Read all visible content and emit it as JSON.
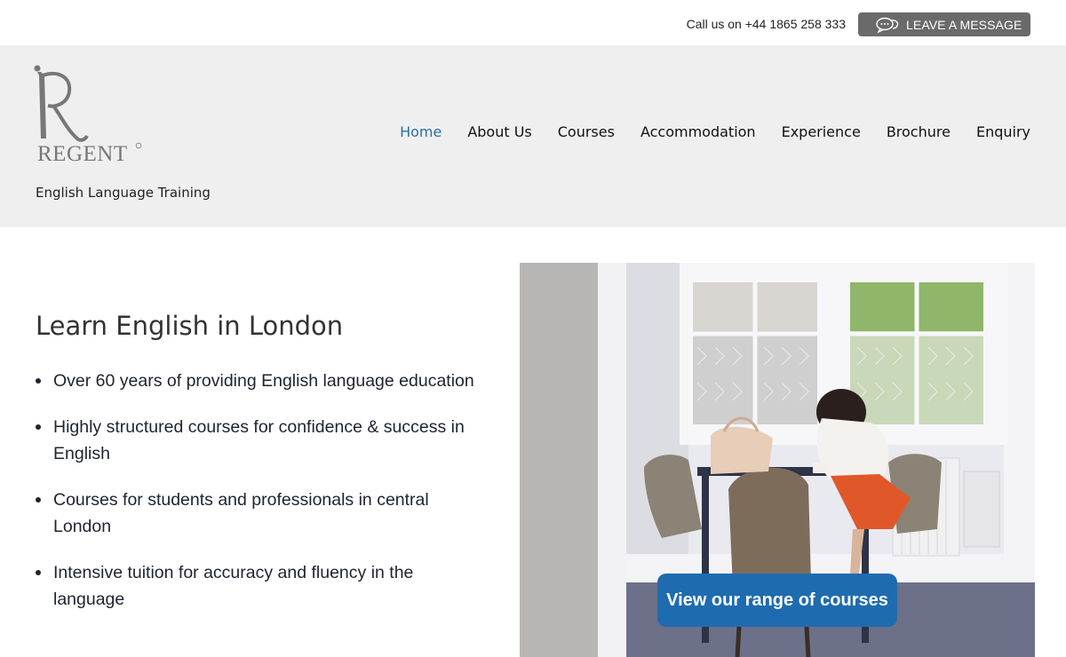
{
  "topbar": {
    "call_text": "Call us on +44 1865 258 333",
    "message_button": "LEAVE A MESSAGE"
  },
  "header": {
    "logo_text": "REGENT",
    "tagline": "English Language Training"
  },
  "nav": {
    "items": [
      {
        "label": "Home",
        "active": true
      },
      {
        "label": "About Us"
      },
      {
        "label": "Courses"
      },
      {
        "label": "Accommodation"
      },
      {
        "label": "Experience"
      },
      {
        "label": "Brochure"
      },
      {
        "label": "Enquiry"
      }
    ]
  },
  "main": {
    "headline": "Learn English in London",
    "bullets": [
      "Over 60 years of providing English language education",
      "Highly structured courses for confidence & success in English",
      "Courses for students and professionals in central London",
      "Intensive tuition for accuracy and fluency in the language"
    ],
    "cta_label": "View our range of courses"
  },
  "colors": {
    "accent": "#1f6bb0",
    "nav_active": "#2a6fa8",
    "header_bg": "#efefef",
    "message_button_bg": "#6a6a6a"
  }
}
